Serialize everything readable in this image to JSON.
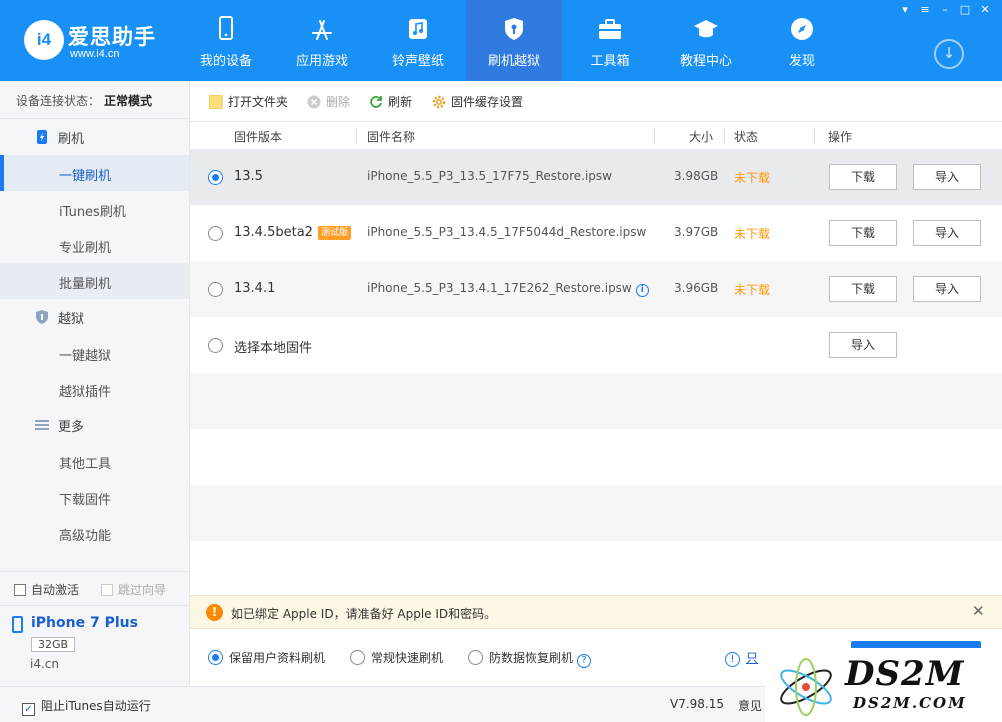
{
  "app": {
    "logo_badge": "i4",
    "logo_name": "爱思助手",
    "logo_url": "www.i4.cn"
  },
  "nav": [
    {
      "label": "我的设备",
      "icon": "phone-icon"
    },
    {
      "label": "应用游戏",
      "icon": "app-store-icon"
    },
    {
      "label": "铃声壁纸",
      "icon": "music-icon"
    },
    {
      "label": "刷机越狱",
      "icon": "shield-key-icon",
      "active": true
    },
    {
      "label": "工具箱",
      "icon": "toolbox-icon"
    },
    {
      "label": "教程中心",
      "icon": "graduation-cap-icon"
    },
    {
      "label": "发现",
      "icon": "compass-icon"
    }
  ],
  "sidebar": {
    "conn_label": "设备连接状态：",
    "conn_value": "正常模式",
    "groups": [
      {
        "label": "刷机",
        "items": [
          "一键刷机",
          "iTunes刷机",
          "专业刷机",
          "批量刷机"
        ]
      },
      {
        "label": "越狱",
        "items": [
          "一键越狱",
          "越狱插件"
        ]
      },
      {
        "label": "更多",
        "items": [
          "其他工具",
          "下载固件",
          "高级功能"
        ]
      }
    ],
    "auto_activate": "自动激活",
    "skip_guide": "跳过向导",
    "device_name": "iPhone 7 Plus",
    "device_capacity": "32GB",
    "device_site": "i4.cn"
  },
  "toolbar": {
    "open_folder": "打开文件夹",
    "delete": "删除",
    "refresh": "刷新",
    "cache_settings": "固件缓存设置"
  },
  "table": {
    "headers": {
      "version": "固件版本",
      "name": "固件名称",
      "size": "大小",
      "status": "状态",
      "action": "操作"
    },
    "rows": [
      {
        "version": "13.5",
        "badge": "",
        "name": "iPhone_5.5_P3_13.5_17F75_Restore.ipsw",
        "size": "3.98GB",
        "status": "未下载",
        "download": "下载",
        "import": "导入",
        "selected": true
      },
      {
        "version": "13.4.5beta2",
        "badge": "测试版",
        "name": "iPhone_5.5_P3_13.4.5_17F5044d_Restore.ipsw",
        "size": "3.97GB",
        "status": "未下载",
        "download": "下载",
        "import": "导入"
      },
      {
        "version": "13.4.1",
        "badge": "",
        "name": "iPhone_5.5_P3_13.4.1_17E262_Restore.ipsw",
        "size": "3.96GB",
        "status": "未下载",
        "download": "下载",
        "import": "导入"
      }
    ],
    "local": {
      "label": "选择本地固件",
      "import": "导入"
    }
  },
  "notice": {
    "message": "如已绑定 Apple ID，请准备好 Apple ID和密码。"
  },
  "options": {
    "keep_data": "保留用户资料刷机",
    "quick": "常规快速刷机",
    "anti_recovery": "防数据恢复刷机",
    "link_fragment": "只"
  },
  "statusbar": {
    "block_itunes": "阻止iTunes自动运行",
    "version": "V7.98.15",
    "feedback": "意见"
  },
  "watermark": {
    "big": "DS2M",
    "small": "DS2M.COM"
  },
  "colors": {
    "primary": "#1890f6",
    "accent": "#1a7cf2",
    "warning": "#ff9800"
  }
}
